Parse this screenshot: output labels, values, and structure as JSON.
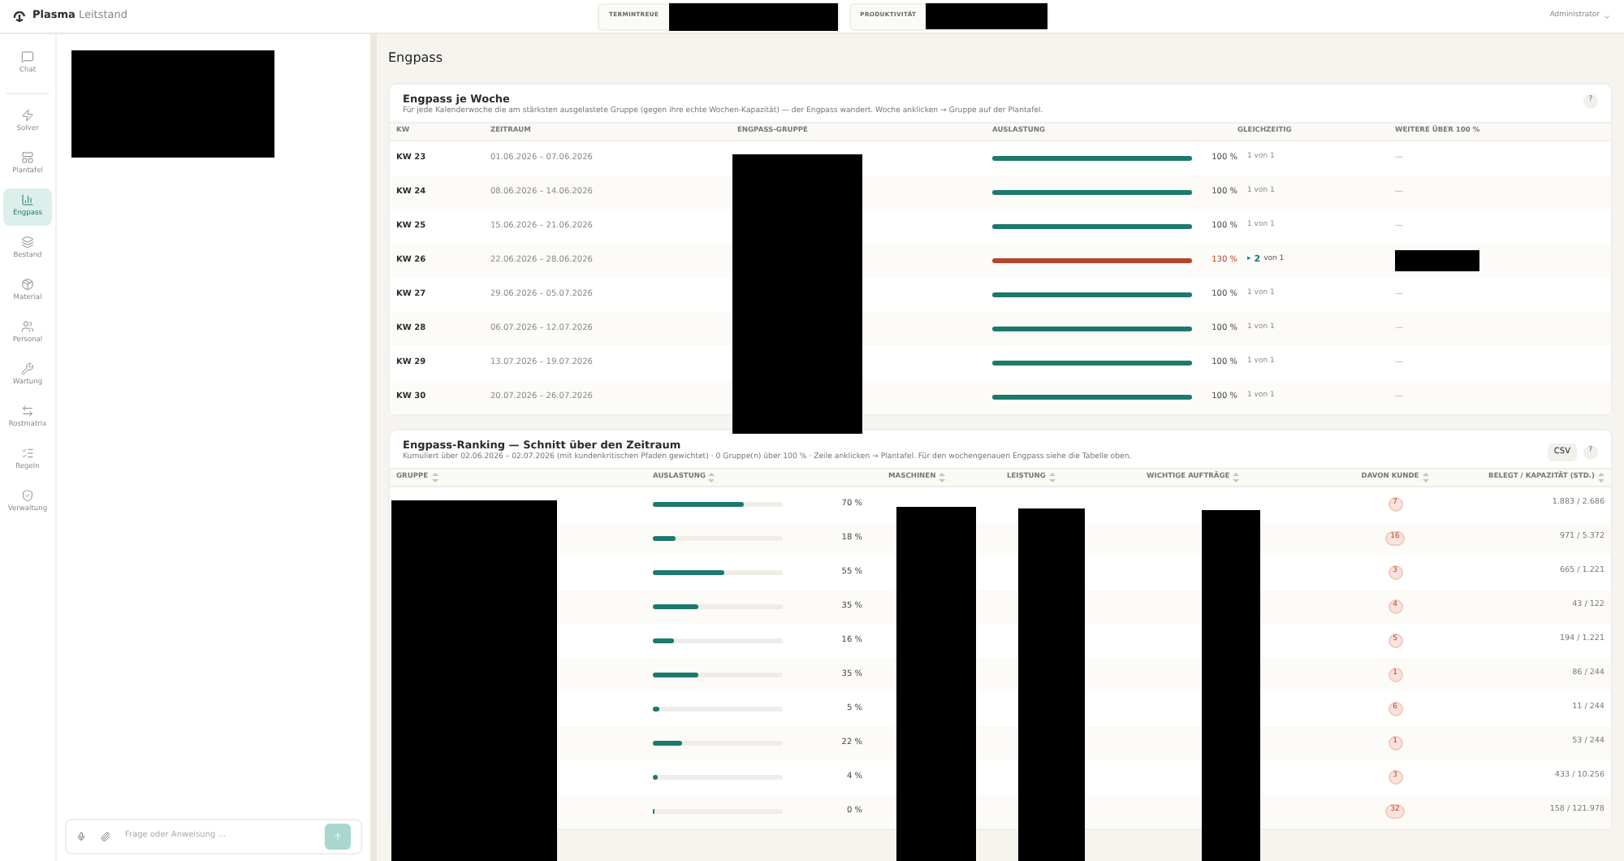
{
  "topbar": {
    "brand_bold": "Plasma",
    "brand_light": "Leitstand",
    "kpis": [
      {
        "label": "TERMINTREUE"
      },
      {
        "label": "PRODUKTIVITÄT"
      }
    ],
    "user": "Administrator"
  },
  "nav": [
    {
      "label": "Chat",
      "selected": false
    },
    {
      "label": "Solver",
      "selected": false
    },
    {
      "label": "Plantafel",
      "selected": false
    },
    {
      "label": "Engpass",
      "selected": true
    },
    {
      "label": "Bestand",
      "selected": false
    },
    {
      "label": "Material",
      "selected": false
    },
    {
      "label": "Personal",
      "selected": false
    },
    {
      "label": "Wartung",
      "selected": false
    },
    {
      "label": "Rostmatrix",
      "selected": false
    },
    {
      "label": "Regeln",
      "selected": false
    },
    {
      "label": "Verwaltung",
      "selected": false
    }
  ],
  "chat": {
    "placeholder": "Frage oder Anweisung ..."
  },
  "page_title": "Engpass",
  "weekly": {
    "title": "Engpass je Woche",
    "help": "?",
    "description": "Für jede Kalenderwoche die am stärksten ausgelastete Gruppe (gegen ihre echte Wochen-Kapazität) — der Engpass wandert. Woche anklicken → Gruppe auf der Plantafel.",
    "columns": [
      "KW",
      "ZEITRAUM",
      "ENGPASS-GRUPPE",
      "AUSLASTUNG",
      "GLEICHZEITIG",
      "WEITERE ÜBER 100 %"
    ],
    "rows": [
      {
        "kw": "KW 23",
        "period": "01.06.2026 – 07.06.2026",
        "level": 1,
        "reading": "100 %",
        "over": false,
        "concurrent": {
          "kind": "plain",
          "text": "1 von 1"
        },
        "more": "—"
      },
      {
        "kw": "KW 24",
        "period": "08.06.2026 – 14.06.2026",
        "level": 1,
        "reading": "100 %",
        "over": false,
        "concurrent": {
          "kind": "plain",
          "text": "1 von 1"
        },
        "more": "—"
      },
      {
        "kw": "KW 25",
        "period": "15.06.2026 – 21.06.2026",
        "level": 1,
        "reading": "100 %",
        "over": false,
        "concurrent": {
          "kind": "plain",
          "text": "1 von 1"
        },
        "more": "—"
      },
      {
        "kw": "KW 26",
        "period": "22.06.2026 – 28.06.2026",
        "level": 1,
        "reading": "130 %",
        "over": true,
        "concurrent": {
          "kind": "expandable",
          "marker": "▸",
          "count": "2",
          "text": "von 1"
        }
      },
      {
        "kw": "KW 27",
        "period": "29.06.2026 – 05.07.2026",
        "level": 1,
        "reading": "100 %",
        "over": false,
        "concurrent": {
          "kind": "plain",
          "text": "1 von 1"
        },
        "more": "—"
      },
      {
        "kw": "KW 28",
        "period": "06.07.2026 – 12.07.2026",
        "level": 1,
        "reading": "100 %",
        "over": false,
        "concurrent": {
          "kind": "plain",
          "text": "1 von 1"
        },
        "more": "—"
      },
      {
        "kw": "KW 29",
        "period": "13.07.2026 – 19.07.2026",
        "level": 1,
        "reading": "100 %",
        "over": false,
        "concurrent": {
          "kind": "plain",
          "text": "1 von 1"
        },
        "more": "—"
      },
      {
        "kw": "KW 30",
        "period": "20.07.2026 – 26.07.2026",
        "level": 1,
        "reading": "100 %",
        "over": false,
        "concurrent": {
          "kind": "plain",
          "text": "1 von 1"
        },
        "more": "—"
      }
    ]
  },
  "ranking": {
    "title": "Engpass-Ranking — Schnitt über den Zeitraum",
    "csv": "CSV",
    "help": "?",
    "description": "Kumuliert über 02.06.2026 – 02.07.2026 (mit kundenkritischen Pfaden gewichtet) · 0 Gruppe(n) über 100 % · Zeile anklicken → Plantafel. Für den wochengenauen Engpass siehe die Tabelle oben.",
    "columns": [
      "GRUPPE",
      "AUSLASTUNG",
      "MASCHINEN",
      "LEISTUNG",
      "WICHTIGE AUFTRÄGE",
      "DAVON KUNDE",
      "BELEGT / KAPAZITÄT (STD.)"
    ],
    "rows": [
      {
        "level": 0.7,
        "reading": "70 %",
        "customer": "7",
        "booked": "1.883 / 2.686"
      },
      {
        "level": 0.18,
        "reading": "18 %",
        "customer": "16",
        "booked": "971 / 5.372"
      },
      {
        "level": 0.55,
        "reading": "55 %",
        "customer": "3",
        "booked": "665 / 1.221"
      },
      {
        "level": 0.35,
        "reading": "35 %",
        "customer": "4",
        "booked": "43 / 122"
      },
      {
        "level": 0.16,
        "reading": "16 %",
        "customer": "5",
        "booked": "194 / 1.221"
      },
      {
        "level": 0.35,
        "reading": "35 %",
        "customer": "1",
        "booked": "86 / 244"
      },
      {
        "level": 0.05,
        "reading": "5 %",
        "customer": "6",
        "booked": "11 / 244"
      },
      {
        "level": 0.22,
        "reading": "22 %",
        "customer": "1",
        "booked": "53 / 244"
      },
      {
        "level": 0.04,
        "reading": "4 %",
        "customer": "3",
        "booked": "433 / 10.256"
      },
      {
        "level": 0,
        "reading": "0 %",
        "customer": "32",
        "booked": "158 / 121.978"
      }
    ]
  }
}
